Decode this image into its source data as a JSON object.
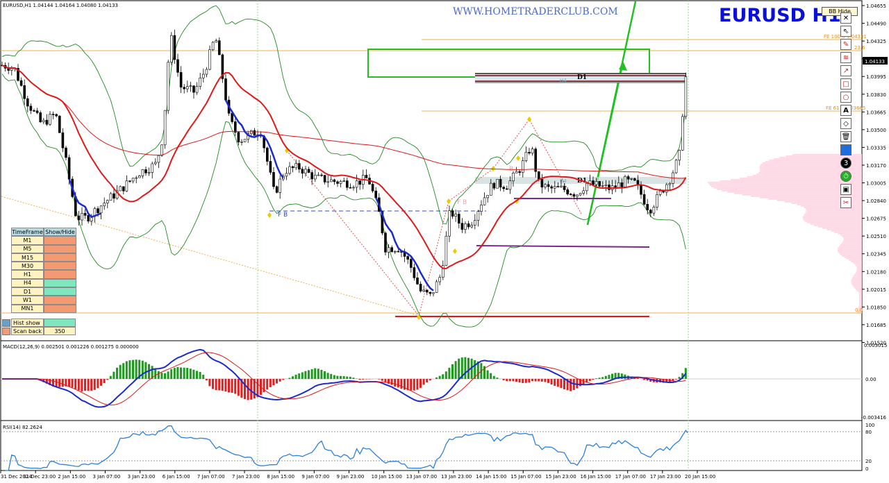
{
  "header": {
    "symbol_info": "EURUSD,H1  1.04144 1.04164 1.04080 1.04133",
    "watermark": "WWW.HOMETRADERCLUB.COM",
    "big_title": "EURUSD  H1",
    "bb_button": "BB Hide"
  },
  "colors": {
    "up_candle": "#000000",
    "bb_green": "#1e8c1e",
    "ma_red": "#e01818",
    "ma_blue": "#1a2ad0",
    "fib_orange": "#f0a020",
    "macd_up": "#1e9a1e",
    "macd_down": "#e02020",
    "rsi_line": "#2a7fe0",
    "title_blue": "#0a10d8"
  },
  "price_axis": {
    "labels": [
      "1.04655",
      "1.04490",
      "1.04325",
      "1.04160",
      "1.03995",
      "1.03830",
      "1.03665",
      "1.03500",
      "1.03335",
      "1.03170",
      "1.03005",
      "1.02840",
      "1.02675",
      "1.02510",
      "1.02345",
      "1.02180",
      "1.02015",
      "1.01850",
      "1.01685",
      "1.01520"
    ],
    "current_price": "1.04133"
  },
  "time_axis": {
    "labels": [
      "31 Dec 2024",
      "31 Dec 23:00",
      "2 Jan 15:00",
      "3 Jan 07:00",
      "3 Jan 23:00",
      "6 Jan 15:00",
      "7 Jan 07:00",
      "7 Jan 23:00",
      "8 Jan 15:00",
      "9 Jan 07:00",
      "9 Jan 23:00",
      "10 Jan 15:00",
      "13 Jan 07:00",
      "13 Jan 23:00",
      "14 Jan 15:00",
      "15 Jan 07:00",
      "15 Jan 23:00",
      "16 Jan 15:00",
      "17 Jan 07:00",
      "17 Jan 23:00",
      "20 Jan 15:00"
    ]
  },
  "annotations": {
    "fe_top": "FE 100.0 1.04331",
    "fe_mid": "FE 61.8 1.03665",
    "fib_zero": "0.0",
    "fib_top_right": "23.6",
    "fb_left": "F B",
    "fb_mid": "F B",
    "b_mid": "B",
    "d1_top": "D1",
    "d1_mid": "D1",
    "h4_top": "H4",
    "h4_mid": "H4"
  },
  "timeframe_panel": {
    "head_left": "TimeFrame",
    "head_right": "Show/Hide",
    "rows": [
      {
        "label": "M1",
        "state": "off"
      },
      {
        "label": "M5",
        "state": "off"
      },
      {
        "label": "M15",
        "state": "off"
      },
      {
        "label": "M30",
        "state": "off"
      },
      {
        "label": "H1",
        "state": "off"
      },
      {
        "label": "H4",
        "state": "on"
      },
      {
        "label": "D1",
        "state": "on"
      },
      {
        "label": "W1",
        "state": "off"
      },
      {
        "label": "MN1",
        "state": "off"
      }
    ],
    "hist_label": "Hist show",
    "scan_label": "Scan back",
    "scan_value": "350"
  },
  "macd": {
    "label": "MACD(12,26,9) 0.002501 0.001226 0.001275 0.000000",
    "axis_top": "0.003015",
    "axis_mid": "0.00",
    "axis_bottom": "-0.003416"
  },
  "rsi": {
    "label": "RSI(14) 82.2624",
    "axis_100": "100",
    "axis_80": "80",
    "axis_20": "20",
    "axis_0": "0"
  },
  "toolbar": {
    "close": "✕",
    "cursor": "⇖",
    "pen": "✎",
    "waves": "≋",
    "arrow": "↗",
    "rect": "□",
    "circle": "○",
    "text": "A",
    "eraser": "◇",
    "trash": "🗑",
    "color": "",
    "num": "3",
    "clock": "⏱",
    "screen": "▣",
    "scissors": "✂"
  },
  "chart_data": {
    "type": "line",
    "title": "EURUSD  H1",
    "xlabel": "",
    "ylabel": "",
    "ylim": [
      1.0152,
      1.0474
    ],
    "ohlc_current": {
      "open": 1.04144,
      "high": 1.04164,
      "low": 1.0408,
      "close": 1.04133
    },
    "x": [
      "31 Dec 2024",
      "31 Dec 23:00",
      "2 Jan 15:00",
      "3 Jan 07:00",
      "3 Jan 23:00",
      "6 Jan 15:00",
      "7 Jan 07:00",
      "7 Jan 23:00",
      "8 Jan 15:00",
      "9 Jan 07:00",
      "9 Jan 23:00",
      "10 Jan 15:00",
      "13 Jan 07:00",
      "13 Jan 23:00",
      "14 Jan 15:00",
      "15 Jan 07:00",
      "15 Jan 23:00",
      "16 Jan 15:00",
      "17 Jan 07:00",
      "17 Jan 23:00",
      "20 Jan 15:00"
    ],
    "series": [
      {
        "name": "close",
        "values": [
          1.041,
          1.0365,
          1.0268,
          1.0285,
          1.0325,
          1.042,
          1.0415,
          1.0335,
          1.03,
          1.0305,
          1.03,
          1.0225,
          1.019,
          1.0268,
          1.0295,
          1.032,
          1.029,
          1.03,
          1.0295,
          1.0305,
          1.0413
        ]
      }
    ],
    "levels": {
      "fe_100": 1.04331,
      "fe_61_8": 1.03665,
      "fib_0": 1.0178
    },
    "macd": {
      "macd": 0.002501,
      "signal": 0.001226,
      "hist": 0.001275
    },
    "rsi": {
      "period": 14,
      "value": 82.2624
    }
  }
}
